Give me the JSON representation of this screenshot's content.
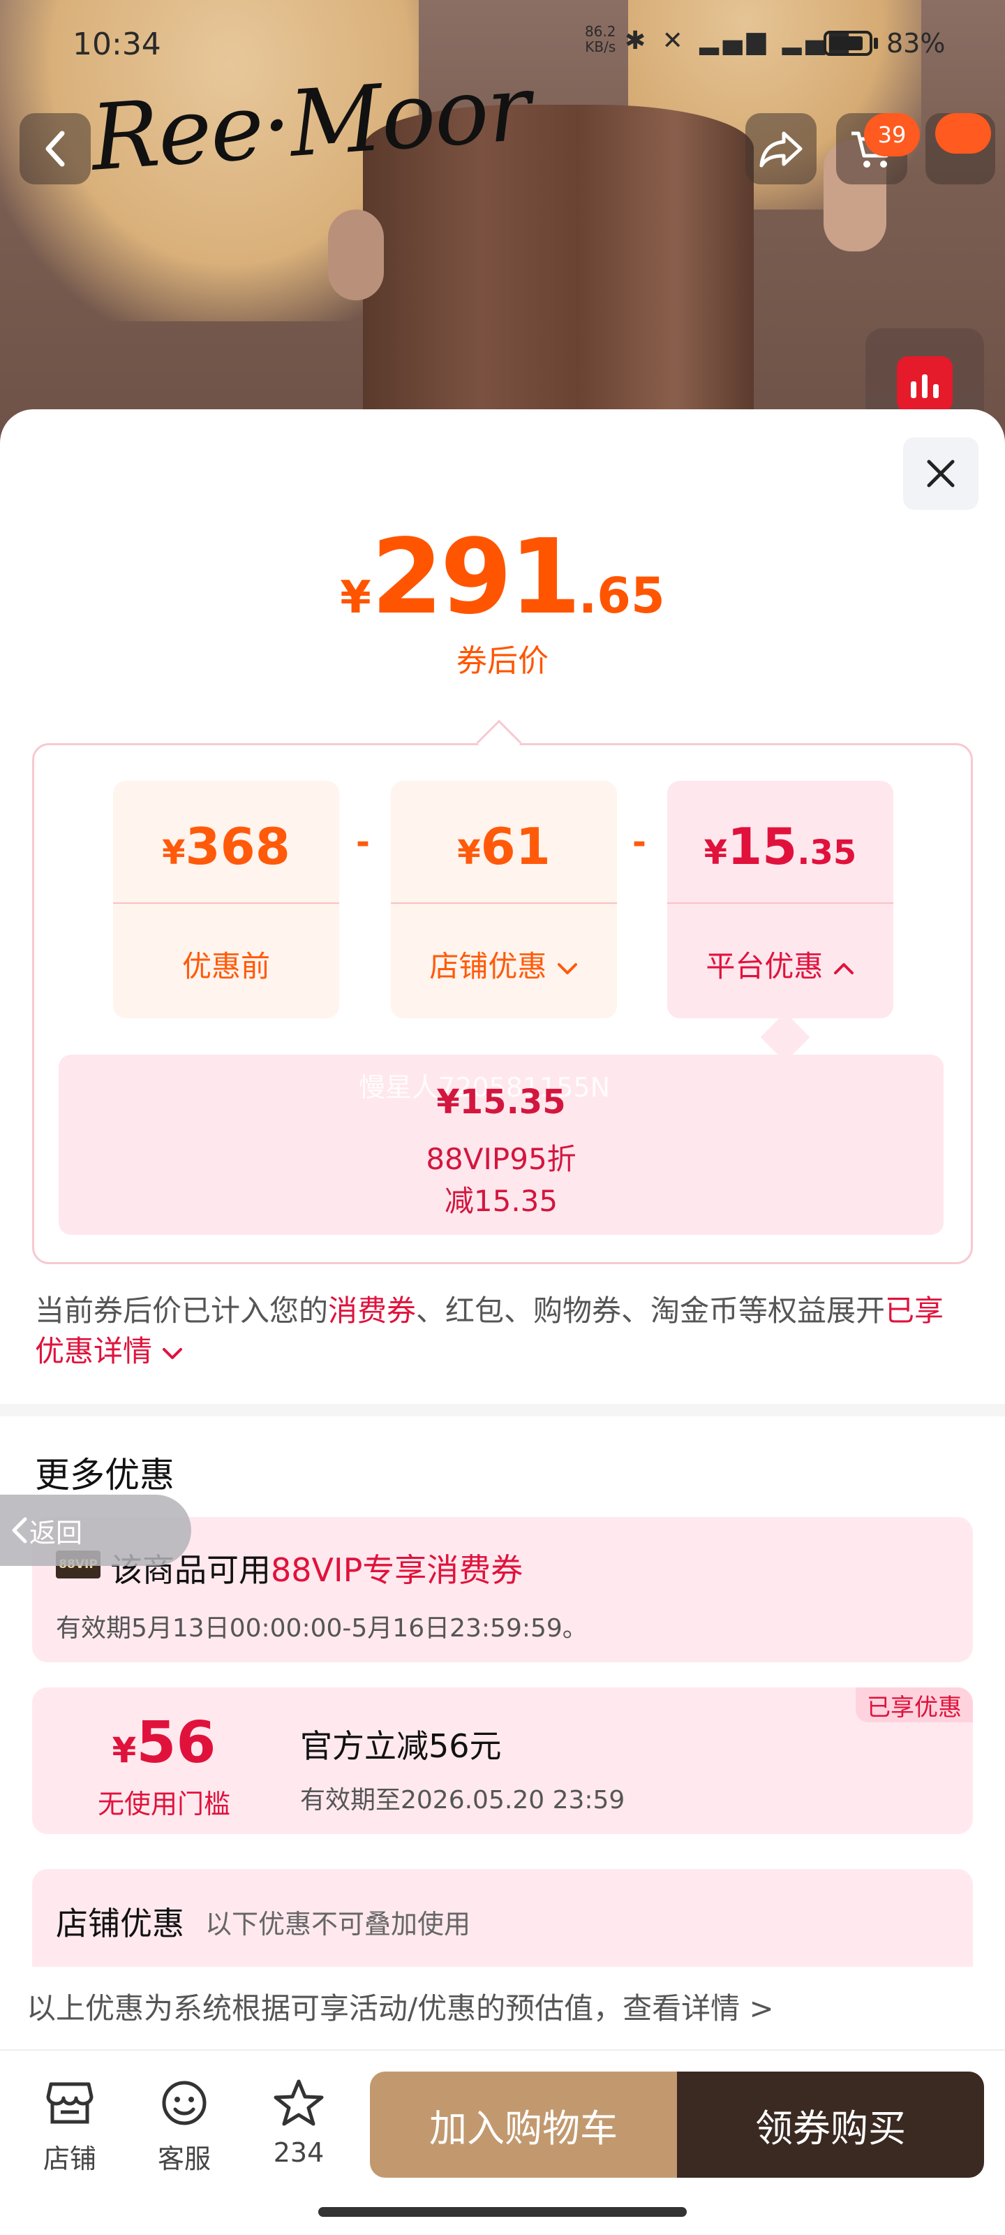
{
  "status_bar": {
    "time": "10:34",
    "net_speed": "86.2",
    "net_unit": "KB/s",
    "icons": "✱ ✕ ▂▄▆ ▂▄▆",
    "battery_pct": "83%"
  },
  "product_header": {
    "brand_logo_text": "Ree·Moor",
    "cart_count": "39"
  },
  "sheet": {
    "final_price": {
      "currency": "¥",
      "integer": "291",
      "decimal": ".65",
      "caption": "券后价"
    },
    "breakdown": {
      "minus_sign": "-",
      "items": [
        {
          "currency": "¥",
          "integer": "368",
          "decimal": "",
          "label": "优惠前"
        },
        {
          "currency": "¥",
          "integer": "61",
          "decimal": "",
          "label": "店铺优惠"
        },
        {
          "currency": "¥",
          "integer": "15",
          "decimal": ".35",
          "label": "平台优惠"
        }
      ],
      "detail": {
        "watermark": "慢星人720581155N",
        "amount": "¥15.35",
        "name": "88VIP95折",
        "sub": "减15.35"
      }
    },
    "note": {
      "part1": "当前券后价已计入您的",
      "highlight1": "消费券",
      "part2": "、红包、购物券、淘金币等权益展开",
      "highlight2": "已享优惠详情"
    },
    "more_offers": {
      "title": "更多优惠",
      "back_label": "返回",
      "vip_coupon": {
        "tag": "88VIP",
        "title_prefix": "该商品可用",
        "title_highlight": "88VIP专享消费券",
        "validity": "有效期5月13日00:00:00-5月16日23:59:59。"
      },
      "official_coupon": {
        "currency": "¥",
        "amount": "56",
        "threshold": "无使用门槛",
        "name": "官方立减56元",
        "validity": "有效期至2026.05.20 23:59",
        "enjoyed_badge": "已享优惠"
      },
      "shop_offers": {
        "title": "店铺优惠",
        "subtitle": "以下优惠不可叠加使用"
      }
    },
    "disclaimer": "以上优惠为系统根据可享活动/优惠的预估值，查看详情 >"
  },
  "bottom_bar": {
    "shop_label": "店铺",
    "service_label": "客服",
    "fav_count": "234",
    "add_to_cart": "加入购物车",
    "buy_with_coupon": "领券购买"
  },
  "colors": {
    "price_orange": "#ff5500",
    "platform_red": "#e0123c",
    "cart_button": "#c2996f",
    "buy_button": "#3a2a22"
  },
  "icons": {
    "back": "chevron-left-icon",
    "share": "share-icon",
    "cart": "cart-icon",
    "more": "more-icon",
    "live": "live-icon",
    "close": "close-icon",
    "shop": "store-icon",
    "service": "smile-icon",
    "favorite": "star-icon"
  }
}
